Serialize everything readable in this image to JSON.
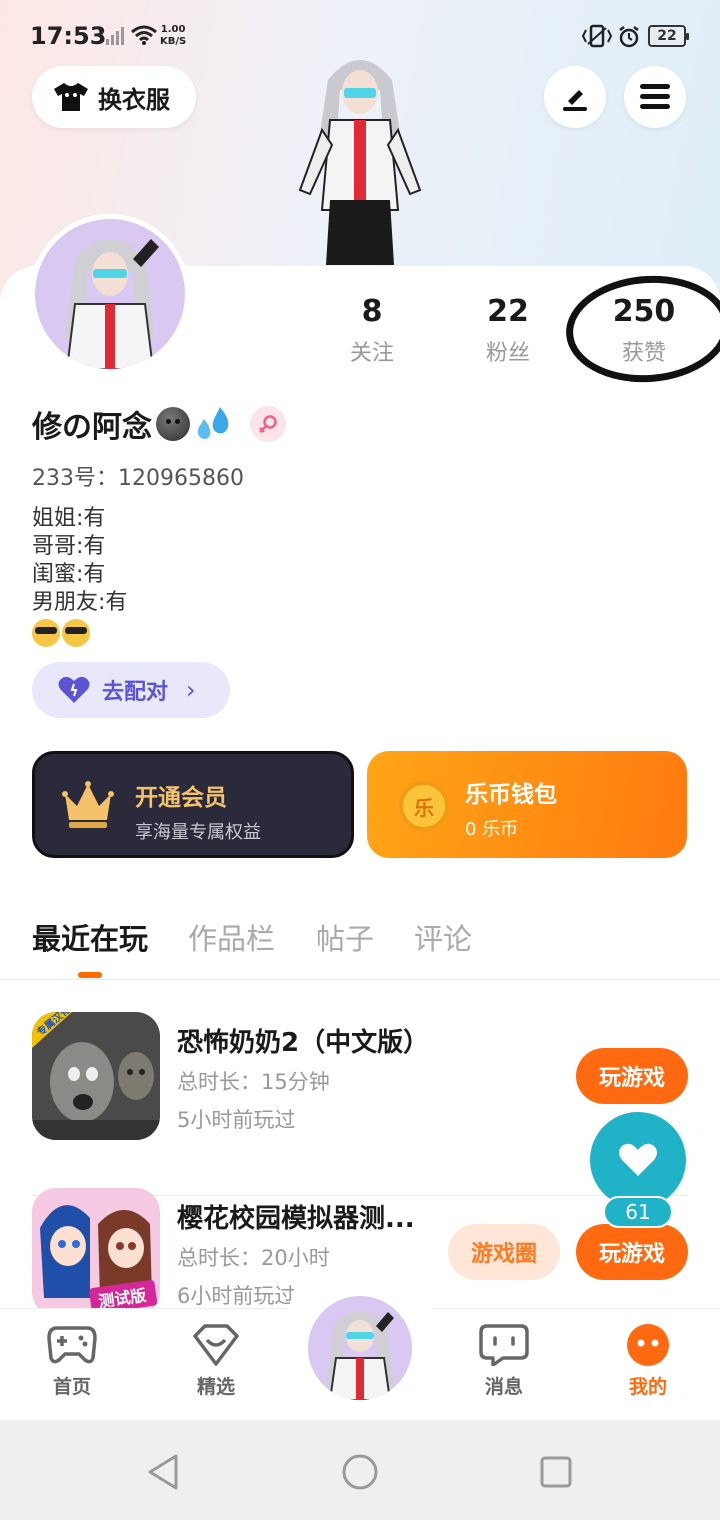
{
  "status_bar": {
    "time": "17:53",
    "net_speed_value": "1.00",
    "net_speed_unit": "KB/S",
    "battery": "22"
  },
  "header": {
    "outfit_label": "换衣服"
  },
  "stats": [
    {
      "value": "8",
      "label": "关注"
    },
    {
      "value": "22",
      "label": "粉丝"
    },
    {
      "value": "250",
      "label": "获赞"
    }
  ],
  "profile": {
    "nickname": "修の阿念",
    "uid": "233号：120965860",
    "bio_lines": [
      "姐姐:有",
      "哥哥:有",
      "闺蜜:有",
      "男朋友:有"
    ]
  },
  "match": {
    "label": "去配对"
  },
  "vip": {
    "title": "开通会员",
    "subtitle": "享海量专属权益"
  },
  "wallet": {
    "coin_glyph": "乐",
    "title": "乐币钱包",
    "subtitle": "0 乐币"
  },
  "tabs": [
    "最近在玩",
    "作品栏",
    "帖子",
    "评论"
  ],
  "games": [
    {
      "title": "恐怖奶奶2（中文版）",
      "duration": "总时长：15分钟",
      "last_played": "5小时前玩过",
      "icon_badge": "专属汉化",
      "play_label": "玩游戏"
    },
    {
      "title": "樱花校园模拟器测...",
      "duration": "总时长：20小时",
      "last_played": "6小时前玩过",
      "icon_badge": "测试版",
      "circle_label": "游戏圈",
      "play_label": "玩游戏"
    }
  ],
  "like_float": {
    "count": "61"
  },
  "bottom_nav": [
    {
      "label": "首页"
    },
    {
      "label": "精选"
    },
    {
      "label": "消息"
    },
    {
      "label": "我的"
    }
  ],
  "colors": {
    "accent": "#ff6a10",
    "match": "#5b55d6",
    "vip_gold": "#f3c26b",
    "like_teal": "#20b2c6"
  }
}
